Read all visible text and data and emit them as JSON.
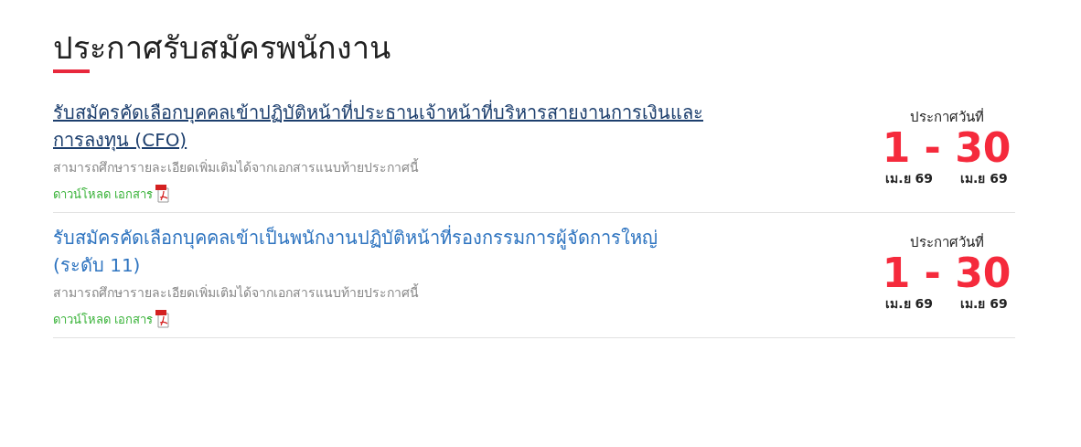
{
  "heading": "ประกาศรับสมัครพนักงาน",
  "announcements": [
    {
      "title": "รับสมัครคัดเลือกบุคคลเข้าปฏิบัติหน้าที่ประธานเจ้าหน้าที่บริหารสายงานการเงินและการลงทุน (CFO)",
      "hovered": true,
      "description": "สามารถศึกษารายละเอียดเพิ่มเติมได้จากเอกสารแนบท้ายประกาศนี้",
      "download": "ดาวน์โหลด เอกสาร",
      "date_label": "ประกาศวันที่",
      "date_range": "1 - 30",
      "start_month": "เม.ย 69",
      "end_month": "เม.ย 69"
    },
    {
      "title": "รับสมัครคัดเลือกบุคคลเข้าเป็นพนักงานปฏิบัติหน้าที่รองกรรมการผู้จัดการใหญ่ (ระดับ 11)",
      "hovered": false,
      "description": "สามารถศึกษารายละเอียดเพิ่มเติมได้จากเอกสารแนบท้ายประกาศนี้",
      "download": "ดาวน์โหลด เอกสาร",
      "date_label": "ประกาศวันที่",
      "date_range": "1 - 30",
      "start_month": "เม.ย 69",
      "end_month": "เม.ย 69"
    }
  ]
}
